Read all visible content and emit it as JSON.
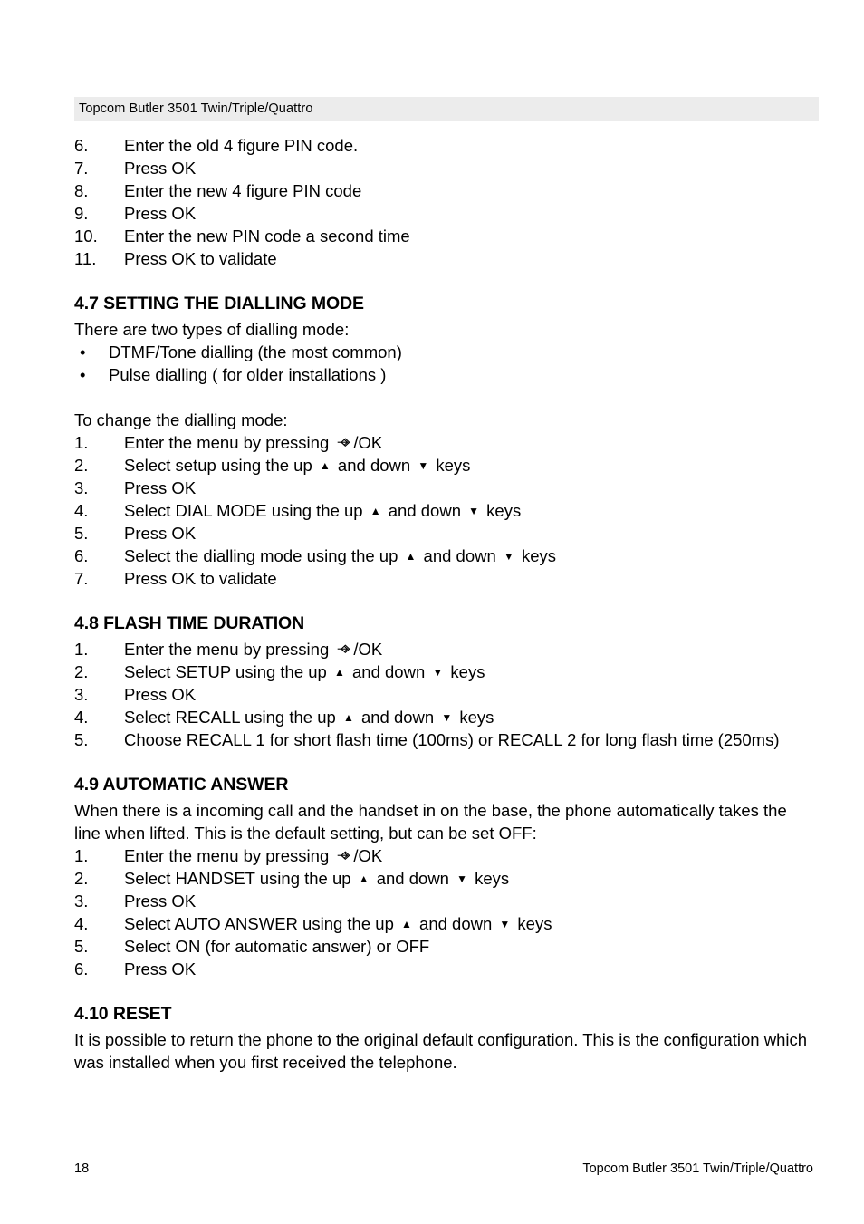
{
  "header": {
    "running_title": "Topcom Butler 3501 Twin/Triple/Quattro"
  },
  "footer": {
    "page_number": "18",
    "running_title": "Topcom Butler 3501 Twin/Triple/Quattro"
  },
  "icons": {
    "menu_key": "menu-key-icon",
    "up_arrow": "up-triangle-icon",
    "down_arrow": "down-triangle-icon"
  },
  "glyphs": {
    "up": "▲",
    "down": "▼"
  },
  "continued_list": {
    "items": [
      {
        "marker": "6.",
        "text": "Enter the old 4 figure PIN code."
      },
      {
        "marker": "7.",
        "text": "Press OK"
      },
      {
        "marker": "8.",
        "text": "Enter the new 4 figure PIN code"
      },
      {
        "marker": "9.",
        "text": "Press OK"
      },
      {
        "marker": "10.",
        "text": "Enter the new PIN code a second time"
      },
      {
        "marker": "11.",
        "text": "Press OK to validate"
      }
    ]
  },
  "section_47": {
    "heading": "4.7 SETTING THE DIALLING MODE",
    "intro": "There are two types of dialling mode:",
    "bullets": [
      {
        "marker": "•",
        "text": "DTMF/Tone dialling (the most common)"
      },
      {
        "marker": "•",
        "text": "Pulse dialling ( for older installations )"
      }
    ],
    "lead_in": "To change the dialling mode:",
    "steps": [
      {
        "marker": "1.",
        "pre": "Enter the menu by pressing ",
        "glyph": "menu",
        "post": "/OK"
      },
      {
        "marker": "2.",
        "pre": "Select setup using the up ",
        "glyph": "updown",
        "mid": " and down ",
        "post": " keys"
      },
      {
        "marker": "3.",
        "pre": "Press OK"
      },
      {
        "marker": "4.",
        "pre": "Select DIAL MODE using the up ",
        "glyph": "updown",
        "mid": " and down ",
        "post": " keys"
      },
      {
        "marker": "5.",
        "pre": "Press OK"
      },
      {
        "marker": "6.",
        "pre": "Select the dialling mode using the up ",
        "glyph": "updown",
        "mid": " and down ",
        "post": " keys"
      },
      {
        "marker": "7.",
        "pre": "Press OK to validate"
      }
    ]
  },
  "section_48": {
    "heading": "4.8 FLASH TIME DURATION",
    "steps": [
      {
        "marker": "1.",
        "pre": "Enter the menu by pressing ",
        "glyph": "menu",
        "post": "/OK"
      },
      {
        "marker": "2.",
        "pre": "Select SETUP using the up ",
        "glyph": "updown",
        "mid": " and down ",
        "post": " keys"
      },
      {
        "marker": "3.",
        "pre": "Press OK"
      },
      {
        "marker": "4.",
        "pre": "Select RECALL using the up ",
        "glyph": "updown",
        "mid": " and down ",
        "post": " keys"
      },
      {
        "marker": "5.",
        "pre": "Choose RECALL 1 for short flash time (100ms) or RECALL 2 for long flash time (250ms)"
      }
    ]
  },
  "section_49": {
    "heading": "4.9 AUTOMATIC ANSWER",
    "paragraph": "When there is a incoming call and the handset in on the base, the phone automatically takes the line when lifted. This is the default setting, but can be set OFF:",
    "steps": [
      {
        "marker": "1.",
        "pre": "Enter the menu by pressing ",
        "glyph": "menu",
        "post": "/OK"
      },
      {
        "marker": "2.",
        "pre": "Select HANDSET using the up ",
        "glyph": "updown",
        "mid": " and down ",
        "post": " keys"
      },
      {
        "marker": "3.",
        "pre": "Press OK"
      },
      {
        "marker": "4.",
        "pre": "Select AUTO ANSWER using the up ",
        "glyph": "updown",
        "mid": " and down ",
        "post": " keys"
      },
      {
        "marker": "5.",
        "pre": "Select ON (for automatic answer) or OFF"
      },
      {
        "marker": "6.",
        "pre": "Press OK"
      }
    ]
  },
  "section_410": {
    "heading": "4.10 RESET",
    "paragraph": "It is possible to return the phone to the original default configuration. This is the configuration which was installed when you first received the telephone."
  }
}
